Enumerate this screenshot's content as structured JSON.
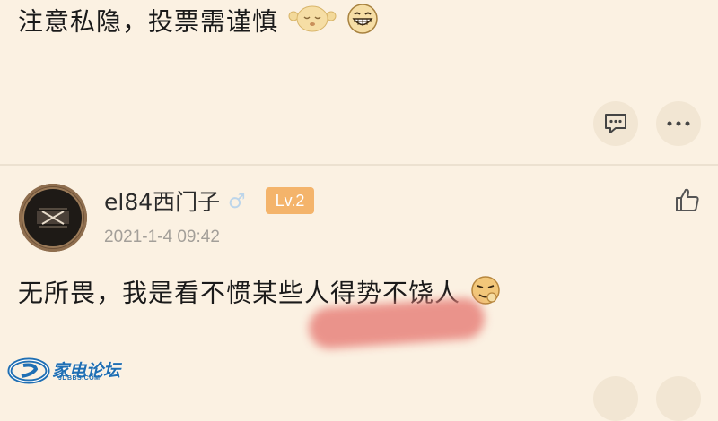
{
  "post1": {
    "text": "注意私隐，投票需谨慎",
    "emojis": [
      "sleep-emoji",
      "grin-emoji"
    ],
    "actions": [
      {
        "name": "comment",
        "icon": "comment-icon"
      },
      {
        "name": "more",
        "icon": "more-icon"
      }
    ]
  },
  "post2": {
    "username": "el84西门子",
    "gender_symbol": "♂",
    "level": "Lv.2",
    "timestamp": "2021-1-4 09:42",
    "text": "无所畏，我是看不惯某些人得势不饶人",
    "emoji": "smirk-emoji",
    "like_icon": "thumbs-up-icon"
  },
  "watermark": {
    "title": "家电论坛",
    "subtitle": "JDBBS.COM"
  },
  "colors": {
    "background": "#fbf1e2",
    "level_badge": "#f4b46b",
    "gender": "#bcd5ea",
    "timestamp": "#a39f99",
    "redaction": "#e8837c",
    "watermark": "#1f6fb4"
  }
}
